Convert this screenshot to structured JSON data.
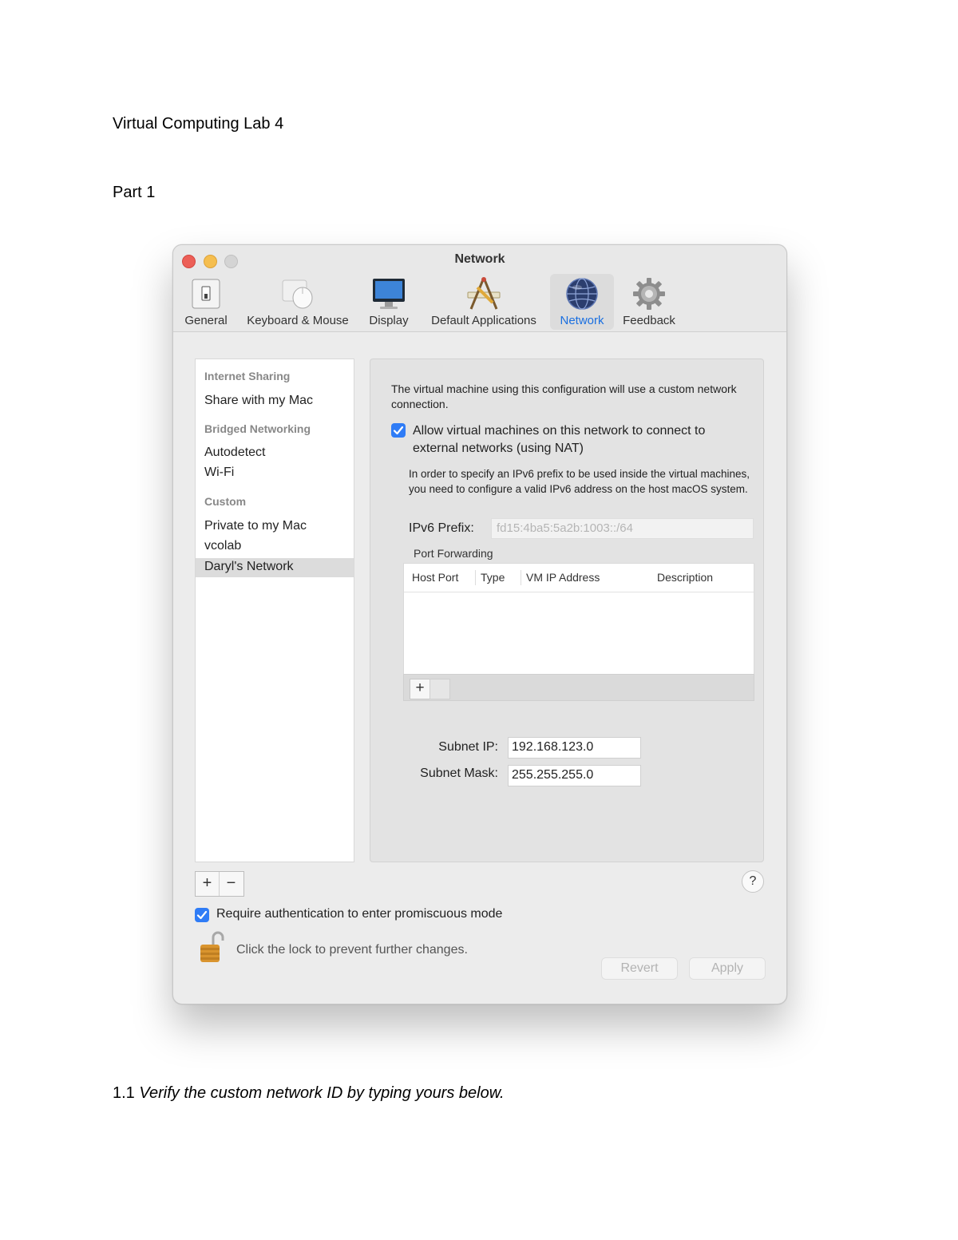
{
  "document": {
    "title": "Virtual Computing Lab 4",
    "part": "Part 1",
    "question_number": "1.1",
    "question_text": "Verify the custom network ID by typing yours below."
  },
  "window": {
    "title": "Network",
    "toolbar": [
      {
        "label": "General",
        "icon": "switch-icon"
      },
      {
        "label": "Keyboard & Mouse",
        "icon": "mouse-icon"
      },
      {
        "label": "Display",
        "icon": "monitor-icon"
      },
      {
        "label": "Default Applications",
        "icon": "applications-icon"
      },
      {
        "label": "Network",
        "icon": "globe-icon",
        "active": true
      },
      {
        "label": "Feedback",
        "icon": "gear-icon"
      }
    ]
  },
  "sidebar": {
    "sections": [
      {
        "header": "Internet Sharing",
        "items": [
          "Share with my Mac"
        ]
      },
      {
        "header": "Bridged Networking",
        "items": [
          "Autodetect",
          "Wi-Fi"
        ]
      },
      {
        "header": "Custom",
        "items": [
          "Private to my Mac",
          "vcolab",
          "Daryl's Network"
        ]
      }
    ],
    "selected": "Daryl's Network",
    "add_label": "+",
    "remove_label": "−"
  },
  "content": {
    "description": "The virtual machine using this configuration will use a custom network connection.",
    "nat_label": "Allow virtual machines on this network to connect to external networks (using NAT)",
    "nat_checked": true,
    "ipv6_note": "In order to specify an IPv6 prefix to be used inside the virtual machines, you need to configure a valid IPv6 address on the host macOS system.",
    "ipv6_label": "IPv6 Prefix:",
    "ipv6_value": "fd15:4ba5:5a2b:1003::/64",
    "port_forwarding_label": "Port Forwarding",
    "pf_columns": [
      "Host Port",
      "Type",
      "VM IP Address",
      "Description"
    ],
    "pf_add_label": "+",
    "subnet_ip_label": "Subnet IP:",
    "subnet_ip_value": "192.168.123.0",
    "subnet_mask_label": "Subnet Mask:",
    "subnet_mask_value": "255.255.255.0"
  },
  "footer": {
    "help_label": "?",
    "auth_label": "Require authentication to enter promiscuous mode",
    "auth_checked": true,
    "lock_label": "Click the lock to prevent further changes.",
    "revert_label": "Revert",
    "apply_label": "Apply"
  },
  "colors": {
    "accent": "#2f7cf6",
    "active_tab_text": "#1a6fe0",
    "close": "#ec5f57",
    "minimize": "#f5be4f",
    "maximize": "#d4d4d4"
  }
}
